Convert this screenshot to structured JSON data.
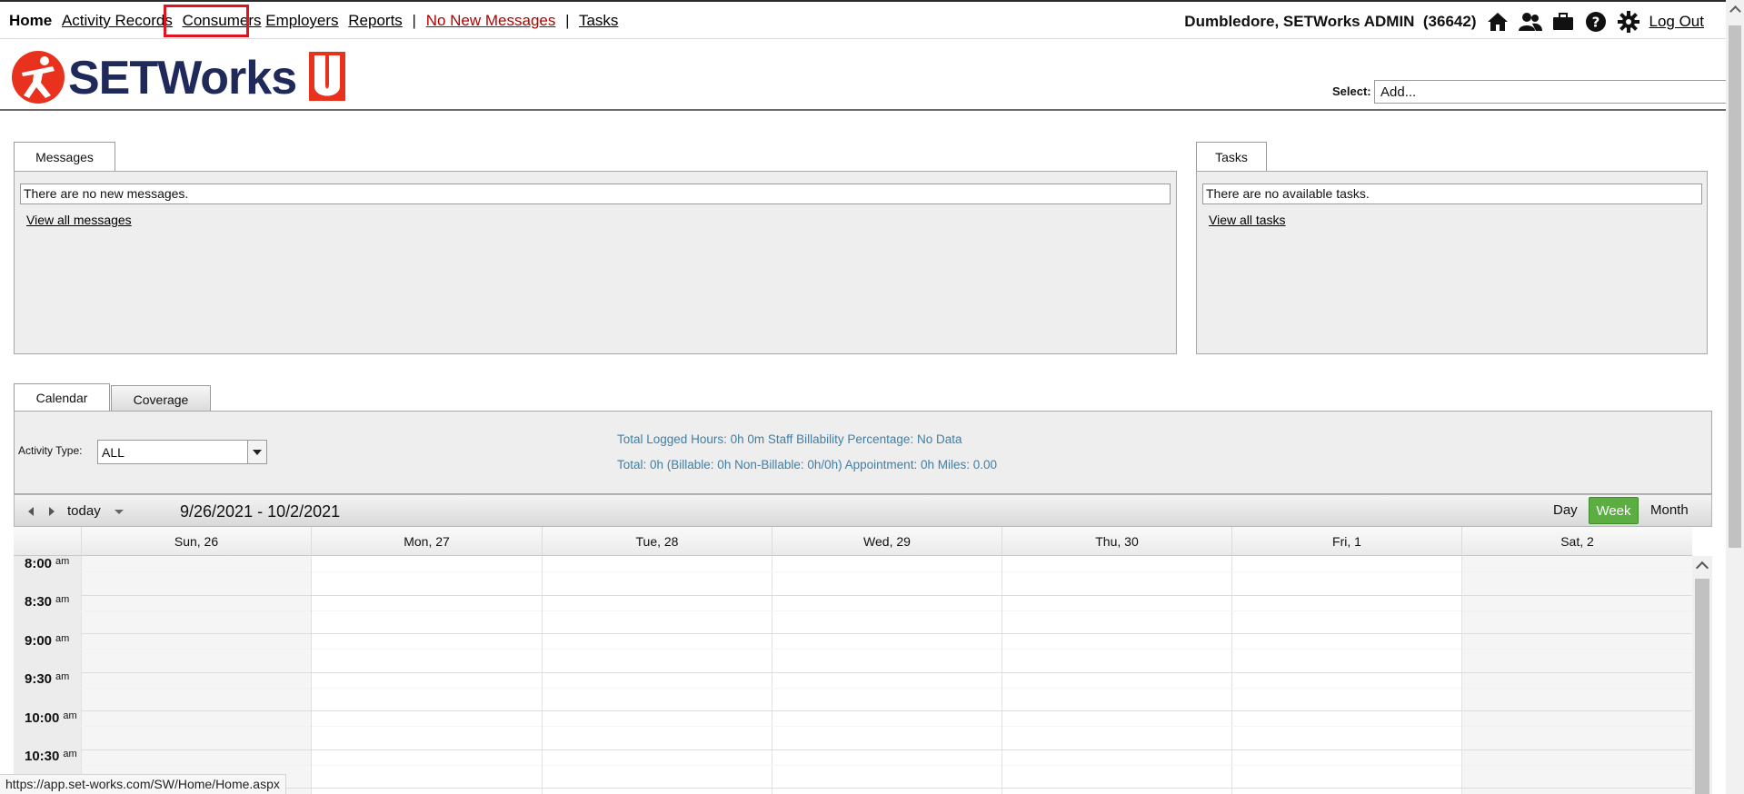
{
  "nav": {
    "home": "Home",
    "activity_records": "Activity Records",
    "consumers": "Consumers",
    "employers": "Employers",
    "reports": "Reports",
    "separator": "|",
    "messages": "No New Messages",
    "tasks": "Tasks"
  },
  "user": {
    "name": "Dumbledore, SETWorks ADMIN",
    "id": "(36642)",
    "logout": "Log Out"
  },
  "logo": {
    "text_set": "SETWorks",
    "text_u": "U",
    "brand_red": "#e8321e",
    "brand_navy": "#1f2a5a"
  },
  "header": {
    "select_label": "Select:",
    "select_value": "Add..."
  },
  "messages": {
    "tab": "Messages",
    "empty_text": "There are no new messages.",
    "view_all": "View all messages"
  },
  "tasks_panel": {
    "tab": "Tasks",
    "empty_text": "There are no available tasks.",
    "view_all": "View all tasks"
  },
  "calendar": {
    "tabs": [
      "Calendar",
      "Coverage"
    ],
    "activity_type_label": "Activity Type:",
    "activity_type_value": "ALL",
    "stats_line1": "Total Logged Hours: 0h 0m   Staff Billability Percentage: No Data",
    "stats_line2": "Total: 0h   (Billable: 0h   Non-Billable: 0h/0h)   Appointment: 0h   Miles: 0.00",
    "today": "today",
    "date_range": "9/26/2021 - 10/2/2021",
    "views": [
      "Day",
      "Week",
      "Month"
    ],
    "days": [
      "Sun, 26",
      "Mon, 27",
      "Tue, 28",
      "Wed, 29",
      "Thu, 30",
      "Fri, 1",
      "Sat, 2"
    ],
    "times": [
      "8:00",
      "8:30",
      "9:00",
      "9:30",
      "10:00",
      "10:30"
    ],
    "ampm": "am"
  },
  "status_url": "https://app.set-works.com/SW/Home/Home.aspx"
}
